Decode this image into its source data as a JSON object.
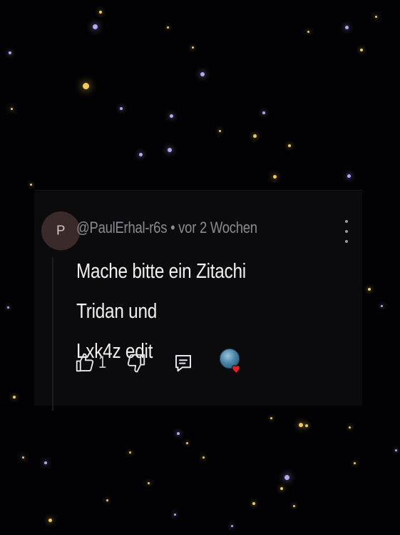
{
  "comment": {
    "avatar_letter": "P",
    "author": "@PaulErhal-r6s",
    "separator": " • ",
    "time_ago": "vor 2 Wochen",
    "text_line1": "Mache bitte ein Zitachi Tridan und",
    "text_line2": "Lxk4z edit",
    "like_count": "1"
  },
  "icons": {
    "like": "thumbs-up-icon",
    "dislike": "thumbs-down-icon",
    "reply": "reply-icon",
    "more": "more-vert-icon",
    "creator_heart": "heart-icon"
  },
  "colors": {
    "background": "#020204",
    "card": "#0b0a0c",
    "text_primary": "#f2f0ef",
    "text_secondary": "#8c8a8f",
    "heart": "#e0202a",
    "star_gold": "#f2c95a",
    "star_violet": "#b9a6f2"
  }
}
